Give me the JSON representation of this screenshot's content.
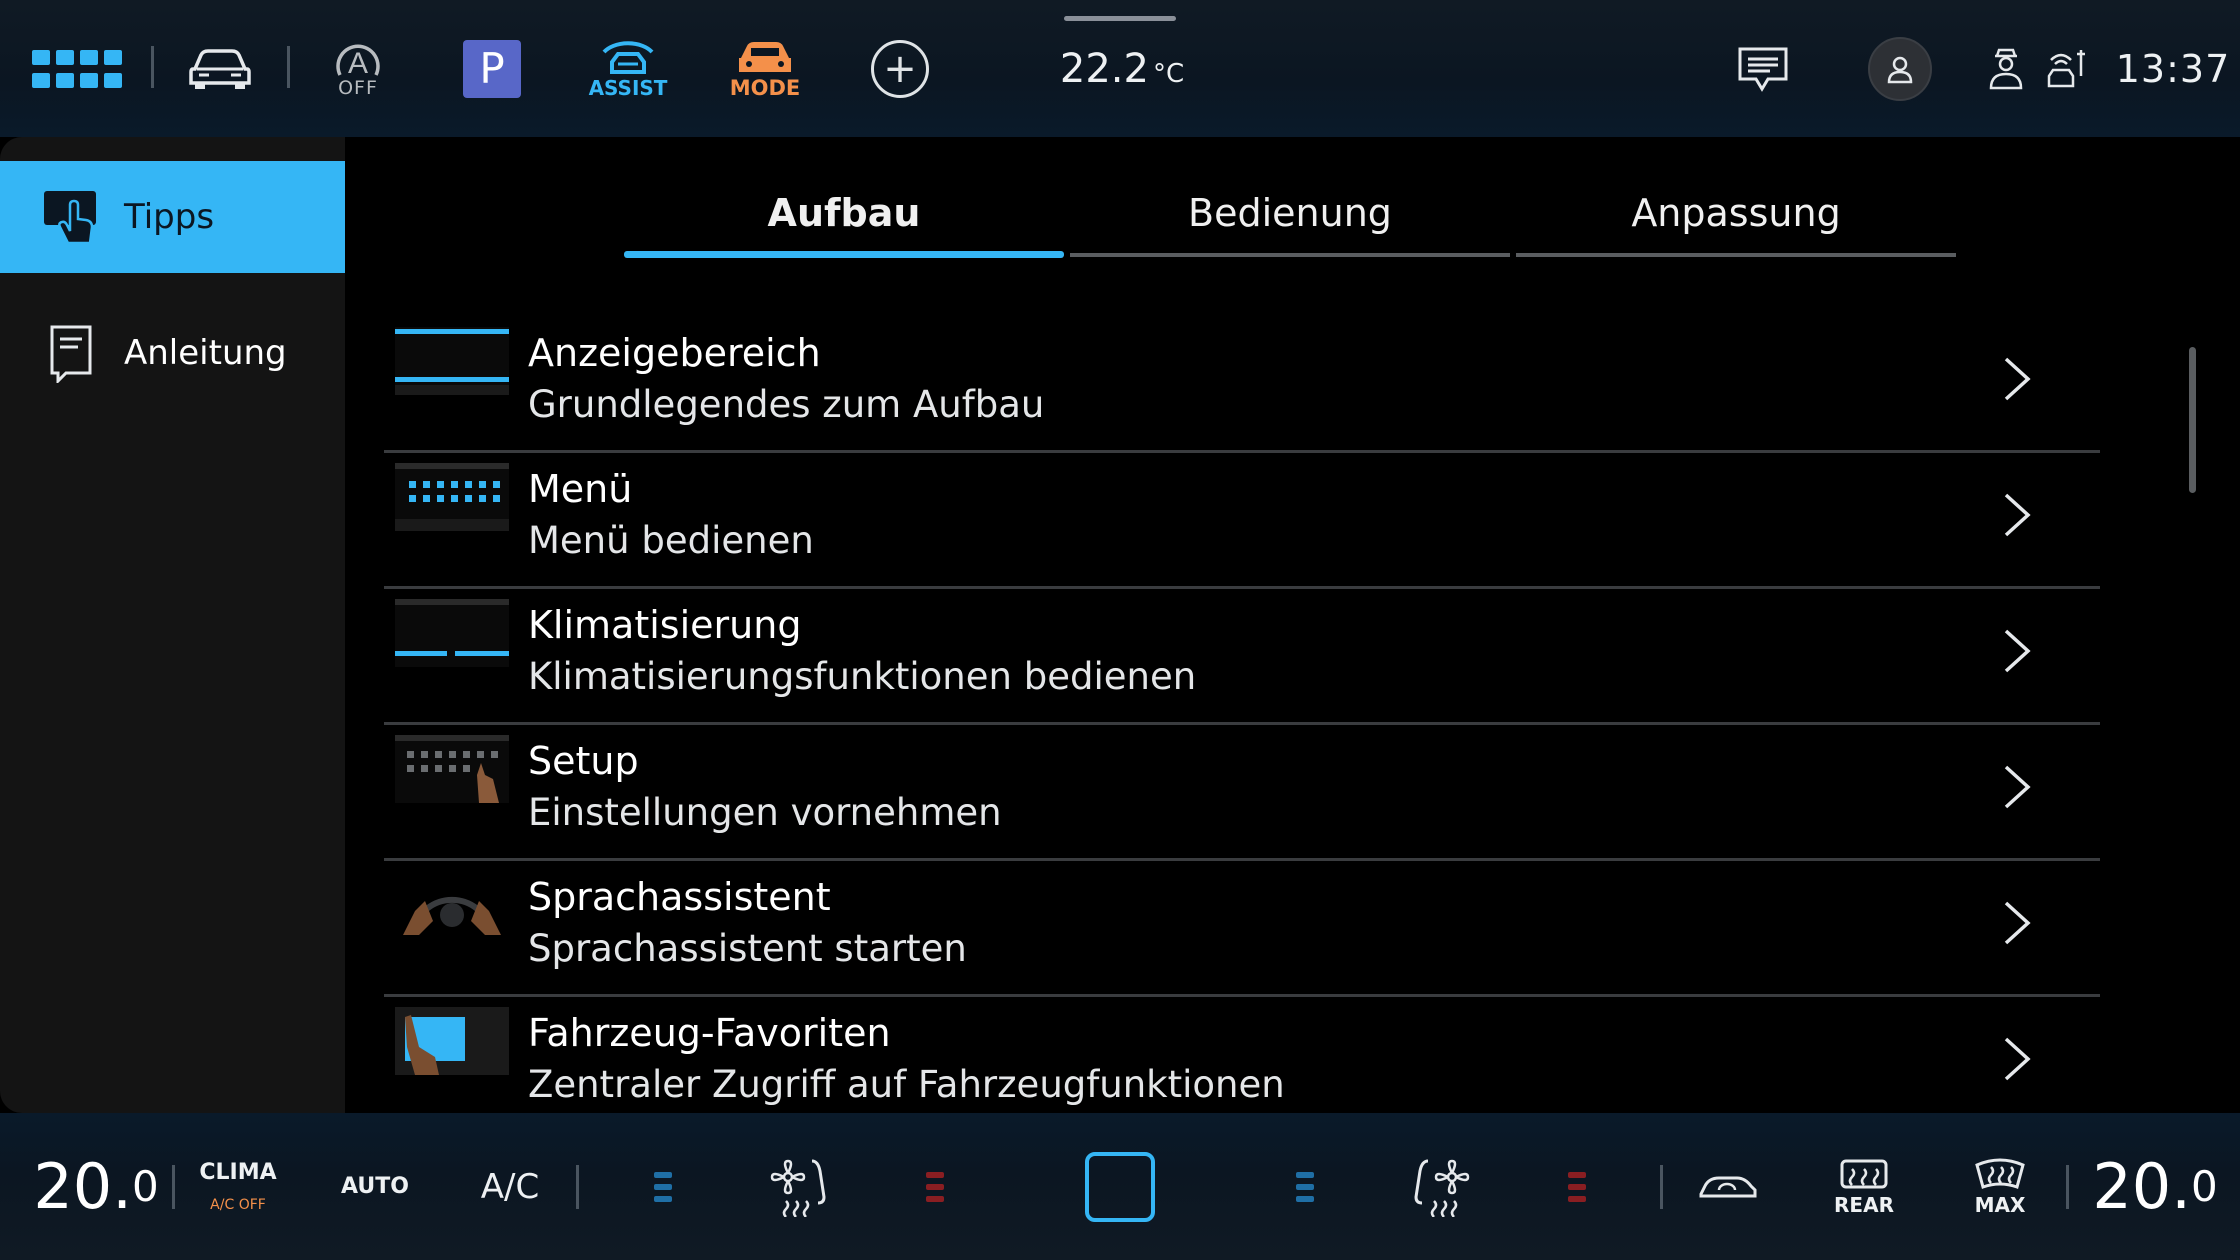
{
  "topbar": {
    "autohold_sub": "OFF",
    "parking_label": "P",
    "assist_label": "ASSIST",
    "mode_label": "MODE",
    "temperature": "22.2",
    "temperature_unit": "°C",
    "clock": "13:37"
  },
  "sidebar": {
    "items": [
      {
        "label": "Tipps",
        "icon": "touch-hand-icon",
        "active": true
      },
      {
        "label": "Anleitung",
        "icon": "manual-book-icon",
        "active": false
      }
    ]
  },
  "tabs": [
    {
      "label": "Aufbau",
      "active": true
    },
    {
      "label": "Bedienung",
      "active": false
    },
    {
      "label": "Anpassung",
      "active": false
    }
  ],
  "list": [
    {
      "title": "Anzeigebereich",
      "subtitle": "Grundlegendes zum Aufbau",
      "thumb": "display-area-thumb"
    },
    {
      "title": "Menü",
      "subtitle": "Menü bedienen",
      "thumb": "menu-thumb"
    },
    {
      "title": "Klimatisierung",
      "subtitle": "Klimatisierungsfunktionen bedienen",
      "thumb": "climate-thumb"
    },
    {
      "title": "Setup",
      "subtitle": "Einstellungen vornehmen",
      "thumb": "setup-thumb"
    },
    {
      "title": "Sprachassistent",
      "subtitle": "Sprachassistent starten",
      "thumb": "steering-wheel-thumb"
    },
    {
      "title": "Fahrzeug-Favoriten",
      "subtitle": "Zentraler Zugriff auf Fahrzeugfunktionen",
      "thumb": "favorites-thumb"
    }
  ],
  "climate": {
    "left_temp_int": "20.",
    "left_temp_dec": "0",
    "clima_label": "CLIMA",
    "ac_off_label": "A/C OFF",
    "auto_label": "AUTO",
    "ac_label": "A/C",
    "rear_label": "REAR",
    "max_label": "MAX",
    "right_temp_int": "20.",
    "right_temp_dec": "0"
  },
  "colors": {
    "accent": "#35b6f5",
    "mode_orange": "#f4904a",
    "parking_blue": "#5867c8",
    "heat_red": "#8a1e22"
  }
}
